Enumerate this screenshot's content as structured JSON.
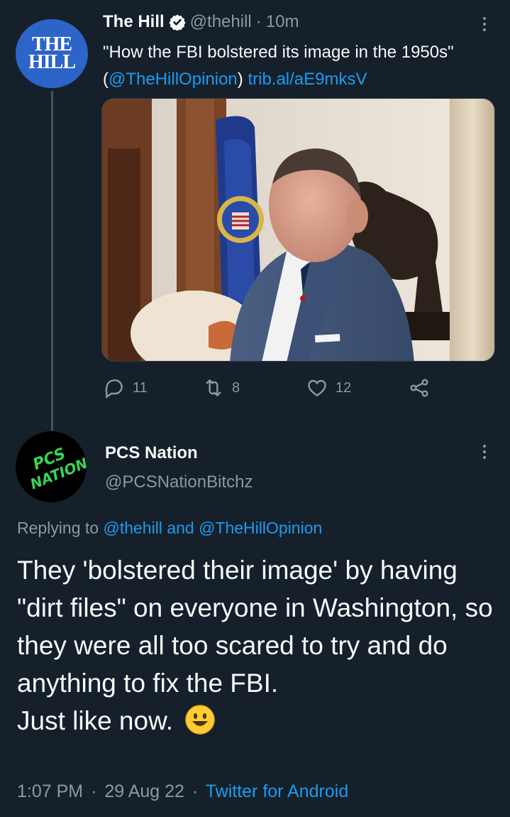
{
  "parent_tweet": {
    "avatar_text": [
      "THE",
      "HILL"
    ],
    "display_name": "The Hill",
    "handle": "@thehill",
    "separator": "·",
    "time_ago": "10m",
    "text_quote": "\"How the FBI bolstered its image in the 1950s\" (",
    "mention": "@TheHillOpinion",
    "text_after_mention": ") ",
    "link": "trib.al/aE9mksV",
    "image_icon": "photo-of-man-in-suit-with-flag",
    "actions": {
      "reply_count": "11",
      "retweet_count": "8",
      "like_count": "12"
    }
  },
  "reply_tweet": {
    "avatar_text": [
      "PCS",
      "NATION"
    ],
    "display_name": "PCS Nation",
    "handle": "@PCSNationBitchz",
    "replying_prefix": "Replying to ",
    "replying_targets": "@thehill and @TheHillOpinion",
    "text": "They 'bolstered their image' by having \"dirt files\" on everyone in Washington, so they were all too scared to try and do anything to fix the FBI.",
    "text_line2": "Just like now.",
    "emoji": "smiley-emoji",
    "time": "1:07 PM",
    "separator": "·",
    "date": "29 Aug 22",
    "source": "Twitter for Android"
  },
  "colors": {
    "background": "#15202b",
    "link": "#1d9bf0",
    "muted": "#8b98a5",
    "text": "#f7f9f9",
    "hill_blue": "#2d64c8",
    "pcs_green": "#39d353"
  }
}
